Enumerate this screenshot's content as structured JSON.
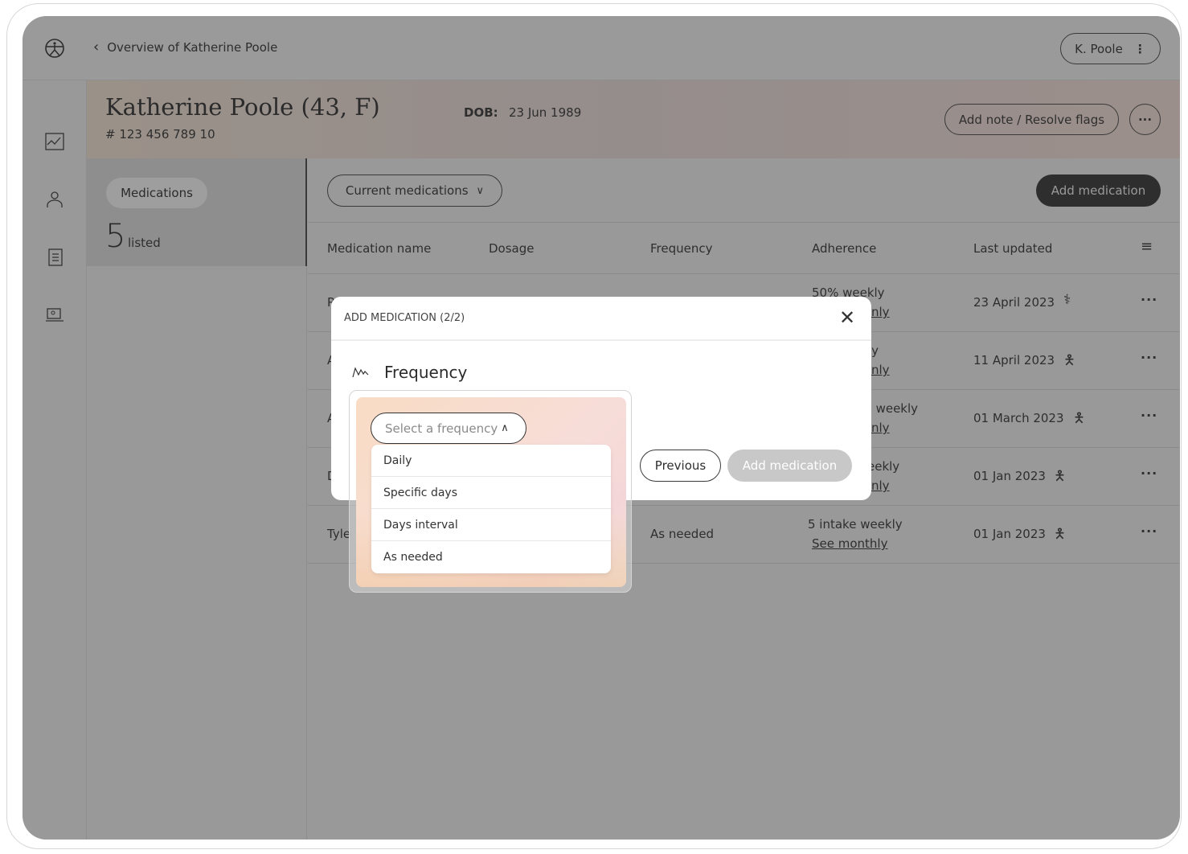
{
  "topbar": {
    "back_label": "Overview of Katherine Poole",
    "user_label": "K. Poole",
    "logo_icon": "vitruvian-logo-icon"
  },
  "rail": {
    "icons": [
      "chart-icon",
      "person-icon",
      "document-icon",
      "devices-icon"
    ]
  },
  "patient": {
    "name": "Katherine Poole (43, F)",
    "id": "# 123 456 789 10",
    "dob_label": "DOB:",
    "dob": "23 Jun 1989",
    "note_button": "Add note / Resolve flags",
    "more": "···"
  },
  "summary": {
    "tab": "Medications",
    "count": "5",
    "count_label": "listed"
  },
  "toolbar": {
    "filter": "Current medications",
    "add": "Add medication"
  },
  "table": {
    "headers": [
      "Medication name",
      "Dosage",
      "Frequency",
      "Adherence",
      "Last updated"
    ],
    "rows": [
      {
        "name": "P",
        "frequency": "",
        "adherence": "50% weekly",
        "link": "nly",
        "updated": "23 April 2023",
        "icon": "stethoscope-icon"
      },
      {
        "name": "A",
        "frequency": "",
        "adherence": "ly",
        "link": "nly",
        "updated": "11 April 2023",
        "icon": "person-icon"
      },
      {
        "name": "A",
        "frequency": "",
        "adherence": "s weekly",
        "link": "nly",
        "updated": "01 March 2023",
        "icon": "person-icon"
      },
      {
        "name": "D",
        "frequency": "",
        "adherence": "eekly",
        "link": "nly",
        "updated": "01 Jan 2023",
        "icon": "person-icon"
      },
      {
        "name": "Tyle",
        "frequency": "As needed",
        "adherence": "5 intake weekly",
        "link": "See monthly",
        "updated": "01 Jan 2023",
        "icon": "person-icon"
      }
    ]
  },
  "modal": {
    "title": "ADD MEDICATION (2/2)",
    "section": "Frequency",
    "select_placeholder": "Select a frequency",
    "options": [
      "Daily",
      "Specific days",
      "Days interval",
      "As needed"
    ],
    "previous": "Previous",
    "submit": "Add medication"
  },
  "colors": {
    "overlay": "#999999",
    "primary": "#2b2b2b",
    "disabled": "#c8c8c8"
  }
}
